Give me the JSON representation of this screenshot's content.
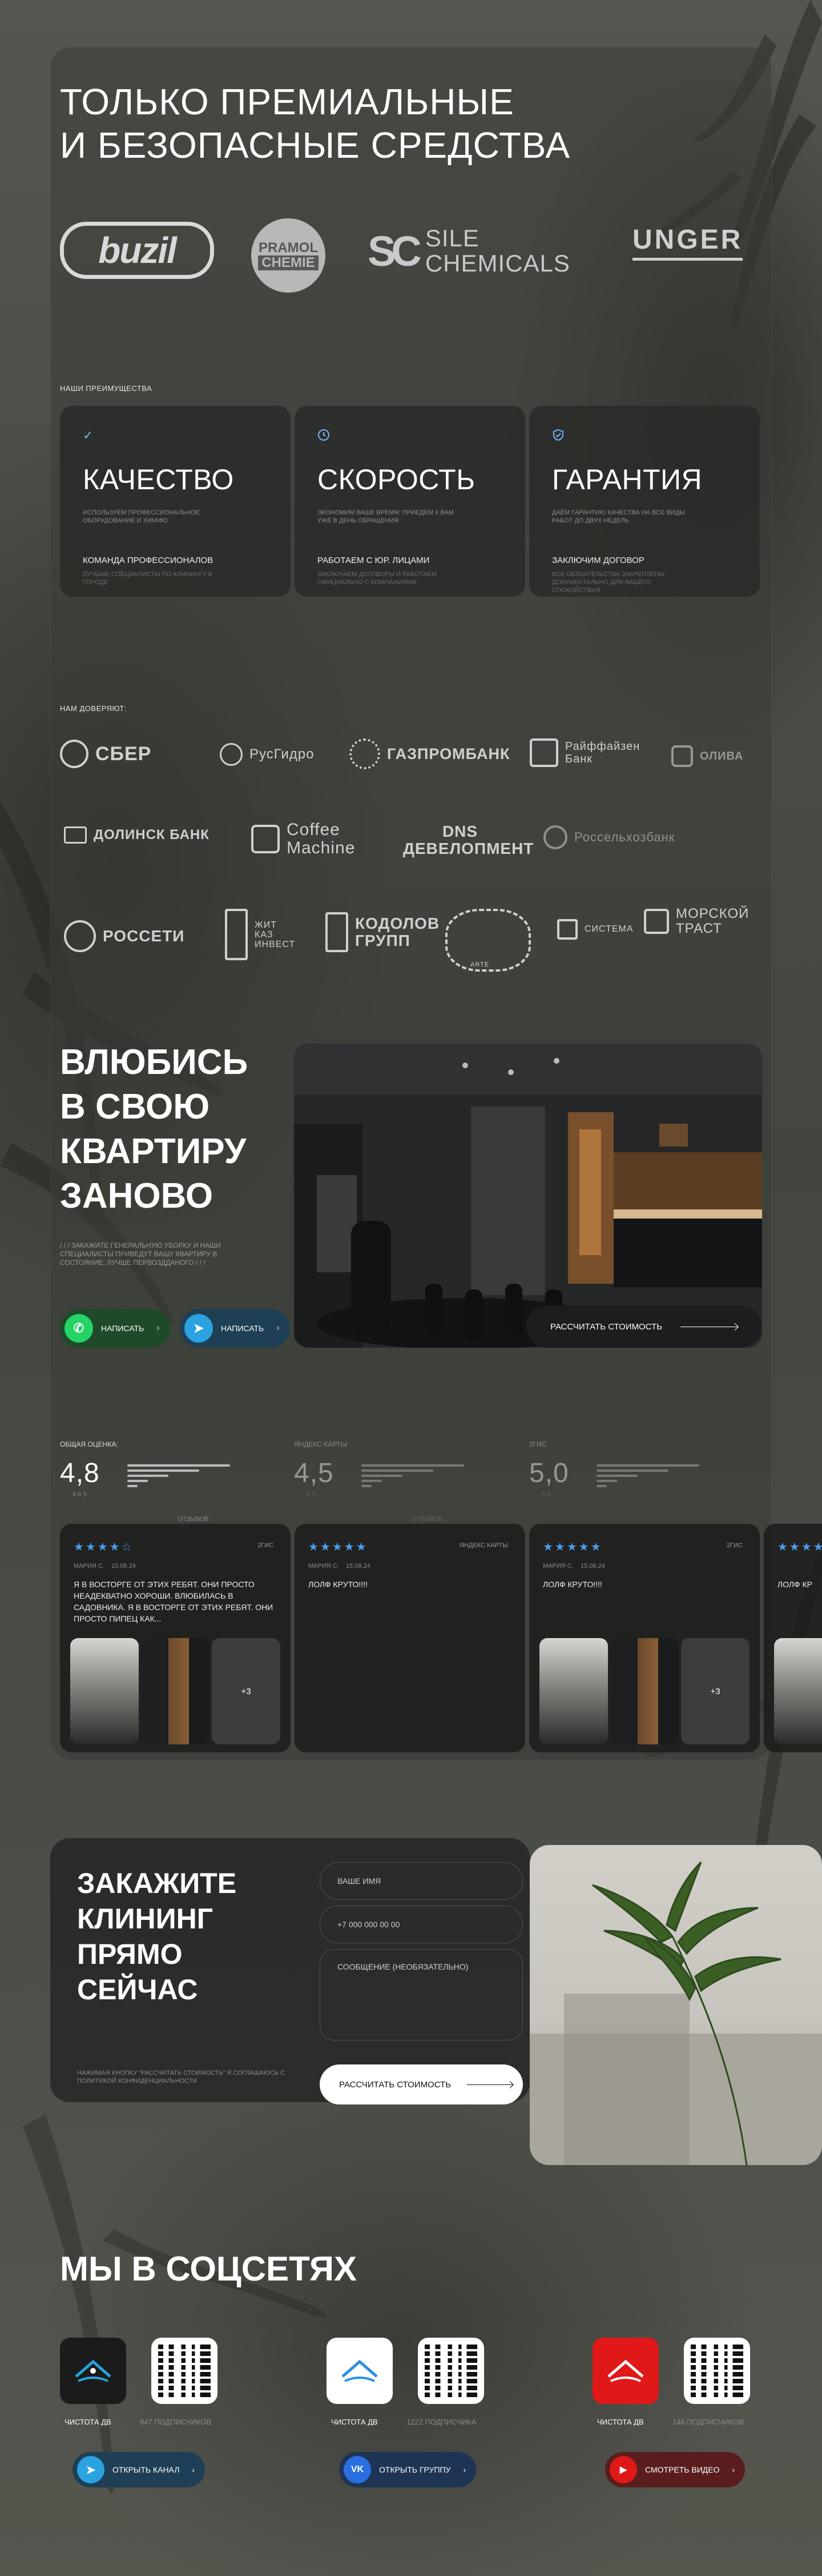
{
  "hero": {
    "title_line1": "Только премиальные",
    "title_line2": "и безопасные средства"
  },
  "brands": {
    "buzil": "buzil",
    "pramol_1": "PRAMOL",
    "pramol_2": "CHEMIE",
    "sile_mark": "SC",
    "sile_1": "SILE",
    "sile_2": "CHEMICALS",
    "unger": "UNGER"
  },
  "advantages": {
    "label": "Наши преимущества",
    "items": [
      {
        "title": "Качество",
        "desc": "Используем профессиональное оборудование и химию",
        "sub": "Команда профессионалов",
        "subdesc": "Лучшие специалисты по клинингу в городе"
      },
      {
        "title": "Скорость",
        "desc": "Экономим ваше время: приедем к вам уже в день обращения",
        "sub": "Работаем с юр. лицами",
        "subdesc": "Заключаем договоры и работаем официально с компаниями"
      },
      {
        "title": "Гарантия",
        "desc": "Даём гарантию качества на все виды работ до двух недель",
        "sub": "Заключим договор",
        "subdesc": "Все обязательства закреплены документально для вашего спокойствия"
      }
    ]
  },
  "partners": {
    "label": "Нам доверяют:",
    "row1": [
      "СБЕР",
      "РусГидро",
      "ГАЗПРОМБАНК",
      "Райффайзен Банк",
      "ОЛИВА"
    ],
    "row2": [
      "ДОЛИНСК БАНК",
      "Coffee Machine",
      "DNS ДЕВЕЛОПМЕНТ",
      "Россельхозбанк"
    ],
    "row3": [
      "РОССЕТИ",
      "ЖИТ КАЗ ИНВЕСТ",
      "КОДОЛОВ ГРУПП",
      "ARTE",
      "СИСТЕМА",
      "МОРСКОЙ ТРАСТ"
    ]
  },
  "love": {
    "title_1": "Влюбись",
    "title_2": "в свою",
    "title_3": "квартиру",
    "title_4": "заново",
    "desc": "/ / / Закажите генеральную уборку и наши специалисты приведут вашу квартиру в состояние, лучше первоздданого / / /",
    "whatsapp_label": "Написать",
    "telegram_label": "Написать",
    "calc_label": "Рассчитать стоимость"
  },
  "ratings": [
    {
      "label": "Общая оценка:",
      "value": "4,8",
      "count_label": "4.8 5",
      "reviews_label": "отзывов 131"
    },
    {
      "label": "Яндекс карты",
      "value": "4,5",
      "count_label": "4.5",
      "reviews_label": "отзывов 141"
    },
    {
      "label": "2ГИС",
      "value": "5,0",
      "count_label": "5.0",
      "reviews_label": ""
    }
  ],
  "reviews": [
    {
      "stars": "★★★★☆",
      "source": "2ГИС",
      "author": "Мария С.",
      "date": "15.08.24",
      "text": "Я в восторге от этих ребят. Они просто неадекватно хороши. Влюбилась в садовника. Я в восторге от этих ребят. Они просто пипец как...",
      "more": "+3"
    },
    {
      "stars": "★★★★★",
      "source": "Яндекс карты",
      "author": "Мария С.",
      "date": "15.08.24",
      "text": "Лолф круто!!!!",
      "more": ""
    },
    {
      "stars": "★★★★★",
      "source": "2ГИС",
      "author": "Мария С.",
      "date": "15.08.24",
      "text": "Лолф круто!!!!",
      "more": "+3"
    },
    {
      "stars": "★★★★★",
      "source": "",
      "author": "",
      "date": "",
      "text": "Лолф кр",
      "more": ""
    }
  ],
  "order": {
    "title_1": "Закажите",
    "title_2": "клининг",
    "title_3": "прямо",
    "title_4": "сейчас",
    "name_placeholder": "Ваше имя",
    "phone_placeholder": "+7 000 000 00 00",
    "message_placeholder": "Сообщение (необязательно)",
    "note": "Нажимая кнопку “Рассчитать стоимость” я соглашаюсь с политикой конфиденциальности",
    "submit_label": "Рассчитать стоимость"
  },
  "social": {
    "title": "Мы в соцсетях",
    "items": [
      {
        "name": "Чистота ДВ",
        "subs": "847 подписчиков",
        "button": "Открыть канал",
        "logo_bg": "#1a1b1a",
        "accent": "#2aa3e0"
      },
      {
        "name": "Чистота ДВ",
        "subs": "1222 подписчика",
        "button": "Открыть группу",
        "logo_bg": "#ffffff",
        "accent": "#2a6fe0"
      },
      {
        "name": "Чистота ДВ",
        "subs": "146 подписчиков",
        "button": "Смотреть видео",
        "logo_bg": "#e01818",
        "accent": "#e01818"
      }
    ]
  }
}
